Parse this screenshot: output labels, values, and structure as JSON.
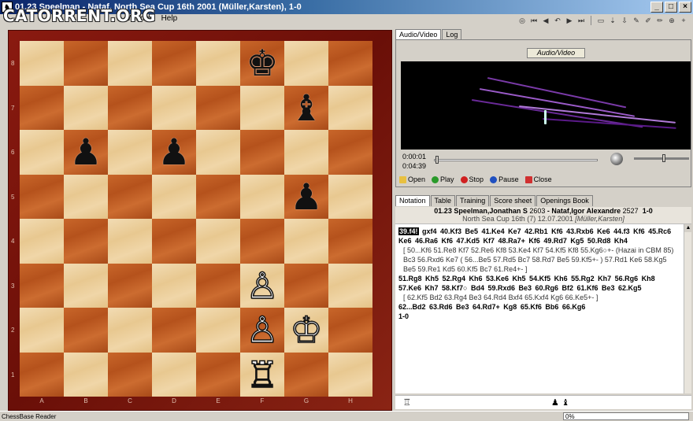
{
  "window": {
    "title": "01.23 Speelman - Nataf, North Sea Cup 16th 2001  (Müller,Karsten), 1-0",
    "minimize": "_",
    "maximize": "□",
    "close": "×"
  },
  "watermark": "CATORRENT.ORG",
  "menu": {
    "window": "Window",
    "help": "Help"
  },
  "board": {
    "files": [
      "A",
      "B",
      "C",
      "D",
      "E",
      "F",
      "G",
      "H"
    ],
    "ranks": [
      "8",
      "7",
      "6",
      "5",
      "4",
      "3",
      "2",
      "1"
    ],
    "light_color": "#efd5a8",
    "dark_color": "#bb5a22",
    "pieces": [
      {
        "square": "f8",
        "glyph": "♚",
        "color": "black",
        "name": "black-king"
      },
      {
        "square": "g7",
        "glyph": "♝",
        "color": "black",
        "name": "black-bishop"
      },
      {
        "square": "b6",
        "glyph": "♟",
        "color": "black",
        "name": "black-pawn-b6"
      },
      {
        "square": "d6",
        "glyph": "♟",
        "color": "black",
        "name": "black-pawn-d6"
      },
      {
        "square": "g5",
        "glyph": "♟",
        "color": "black",
        "name": "black-pawn-g5"
      },
      {
        "square": "f3",
        "glyph": "♙",
        "color": "white",
        "name": "white-pawn-f3"
      },
      {
        "square": "f2",
        "glyph": "♙",
        "color": "white",
        "name": "white-pawn-f2"
      },
      {
        "square": "g2",
        "glyph": "♔",
        "color": "white",
        "name": "white-king"
      },
      {
        "square": "f1",
        "glyph": "♖",
        "color": "white",
        "name": "white-rook"
      }
    ]
  },
  "top_tabs": [
    "Audio/Video",
    "Log"
  ],
  "audio_video": {
    "title": "Audio/Video",
    "time_current": "0:00:01",
    "time_total": "0:04:39",
    "progress": 0.004,
    "volume": 0.55,
    "buttons": {
      "open": "Open",
      "play": "Play",
      "stop": "Stop",
      "pause": "Pause",
      "close": "Close"
    }
  },
  "notation_tabs": [
    "Notation",
    "Table",
    "Training",
    "Score sheet",
    "Openings Book"
  ],
  "game": {
    "line1_players": "01.23 Speelman,Jonathan S",
    "white_elo": "2603",
    "separator": "-",
    "black": "Nataf,Igor Alexandre",
    "black_elo": "2527",
    "result": "1-0",
    "event": "North Sea Cup 16th (7) 12.07.2001",
    "annotator": "[Müller,Karsten]"
  },
  "notation": {
    "current_move": "39.f4!",
    "main1": "gxf4 40.Kf3 Be5 41.Ke4 Ke7 42.Rb1 Kf6 43.Rxb6 Ke6 44.f3 Kf6 45.Rc6 Ke6 46.Ra6 Kf6 47.Kd5 Kf7 48.Ra7+ Kf6 49.Rd7 Kg5 50.Rd8 Kh4",
    "var1": "[ 50...Kf6 51.Re8 Kf7 52.Re6 Kf8 53.Ke4 Kf7 54.Kf5 Kf8 55.Kg6○+- (Hazai in CBM 85) Bc3 56.Rxd6 Ke7 ( 56...Be5 57.Rd5 Bc7 58.Rd7 Be5 59.Kf5+- ) 57.Rd1 Ke6 58.Kg5 Be5 59.Re1 Kd5 60.Kf5 Bc7 61.Re4+- ]",
    "main2": "51.Rg8 Kh5 52.Rg4 Kh6 53.Ke6 Kh5 54.Kf5 Kh6 55.Rg2 Kh7 56.Rg6 Kh8 57.Ke6 Kh7 58.Kf7○ Bd4 59.Rxd6 Be3 60.Rg6 Bf2 61.Kf6 Be3 62.Kg5",
    "var2": "[ 62.Kf5 Bd2 63.Rg4 Be3 64.Rd4 Bxf4 65.Kxf4 Kg6 66.Ke5+- ]",
    "main3": "62...Bd2 63.Rd6 Be3 64.Rd7+ Kg8 65.Kf6 Bb6 66.Kg6",
    "result": "1-0"
  },
  "material": {
    "white": "♖",
    "black": "♟ ♝"
  },
  "status": {
    "text": "ChessBase Reader",
    "progress_text": "0%"
  }
}
